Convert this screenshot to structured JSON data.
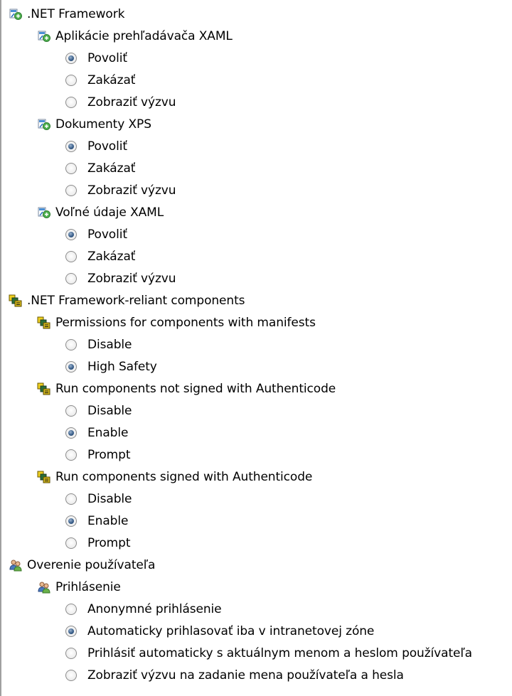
{
  "tree": [
    {
      "label": ".NET Framework",
      "icon": "net-framework-icon",
      "children": [
        {
          "label": "Aplikácie prehľadávača XAML",
          "icon": "net-framework-icon",
          "options": [
            {
              "label": "Povoliť",
              "selected": true
            },
            {
              "label": "Zakázať",
              "selected": false
            },
            {
              "label": "Zobraziť výzvu",
              "selected": false
            }
          ]
        },
        {
          "label": "Dokumenty XPS",
          "icon": "net-framework-icon",
          "options": [
            {
              "label": "Povoliť",
              "selected": true
            },
            {
              "label": "Zakázať",
              "selected": false
            },
            {
              "label": "Zobraziť výzvu",
              "selected": false
            }
          ]
        },
        {
          "label": "Voľné údaje XAML",
          "icon": "net-framework-icon",
          "options": [
            {
              "label": "Povoliť",
              "selected": true
            },
            {
              "label": "Zakázať",
              "selected": false
            },
            {
              "label": "Zobraziť výzvu",
              "selected": false
            }
          ]
        }
      ]
    },
    {
      "label": ".NET Framework-reliant components",
      "icon": "reliant-components-icon",
      "children": [
        {
          "label": "Permissions for components with manifests",
          "icon": "reliant-components-icon",
          "options": [
            {
              "label": "Disable",
              "selected": false
            },
            {
              "label": "High Safety",
              "selected": true
            }
          ]
        },
        {
          "label": "Run components not signed with Authenticode",
          "icon": "reliant-components-icon",
          "options": [
            {
              "label": "Disable",
              "selected": false
            },
            {
              "label": "Enable",
              "selected": true
            },
            {
              "label": "Prompt",
              "selected": false
            }
          ]
        },
        {
          "label": "Run components signed with Authenticode",
          "icon": "reliant-components-icon",
          "options": [
            {
              "label": "Disable",
              "selected": false
            },
            {
              "label": "Enable",
              "selected": true
            },
            {
              "label": "Prompt",
              "selected": false
            }
          ]
        }
      ]
    },
    {
      "label": "Overenie používateľa",
      "icon": "users-icon",
      "children": [
        {
          "label": "Prihlásenie",
          "icon": "users-icon",
          "options": [
            {
              "label": "Anonymné prihlásenie",
              "selected": false
            },
            {
              "label": "Automaticky prihlasovať iba v intranetovej zóne",
              "selected": true
            },
            {
              "label": "Prihlásiť automaticky s aktuálnym menom a heslom používateľa",
              "selected": false
            },
            {
              "label": "Zobraziť výzvu na zadanie mena používateľa a hesla",
              "selected": false
            }
          ]
        }
      ]
    }
  ]
}
